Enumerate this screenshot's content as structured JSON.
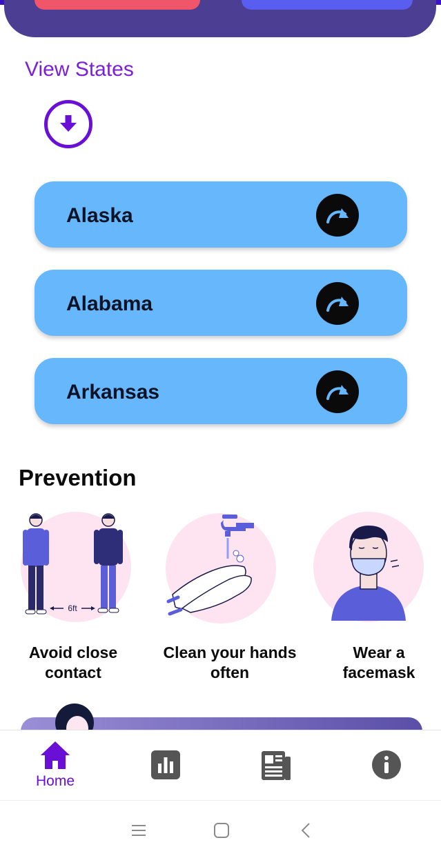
{
  "colors": {
    "header": "#4b3e93",
    "accent": "#6a0fd6",
    "state_card": "#66b7fb",
    "illus_bg": "#fde4f0",
    "figure": "#5a5ed8"
  },
  "states_section": {
    "title": "View States",
    "download_icon": "arrow-down-circle-icon",
    "items": [
      {
        "label": "Alaska",
        "icon": "arrow-redo-icon"
      },
      {
        "label": "Alabama",
        "icon": "arrow-redo-icon"
      },
      {
        "label": "Arkansas",
        "icon": "arrow-redo-icon"
      }
    ]
  },
  "prevention": {
    "title": "Prevention",
    "items": [
      {
        "label_line1": "Avoid close",
        "label_line2": "contact",
        "distance_label": "6ft"
      },
      {
        "label_line1": "Clean your hands",
        "label_line2": "often"
      },
      {
        "label_line1": "Wear a",
        "label_line2": "facemask"
      }
    ]
  },
  "bottom_nav": {
    "items": [
      {
        "icon": "home-icon",
        "label": "Home",
        "active": true
      },
      {
        "icon": "bar-chart-icon",
        "label": "",
        "active": false
      },
      {
        "icon": "newspaper-icon",
        "label": "",
        "active": false
      },
      {
        "icon": "info-icon",
        "label": "",
        "active": false
      }
    ]
  },
  "system_nav": {
    "buttons": [
      "menu-icon",
      "home-square-icon",
      "back-icon"
    ]
  }
}
